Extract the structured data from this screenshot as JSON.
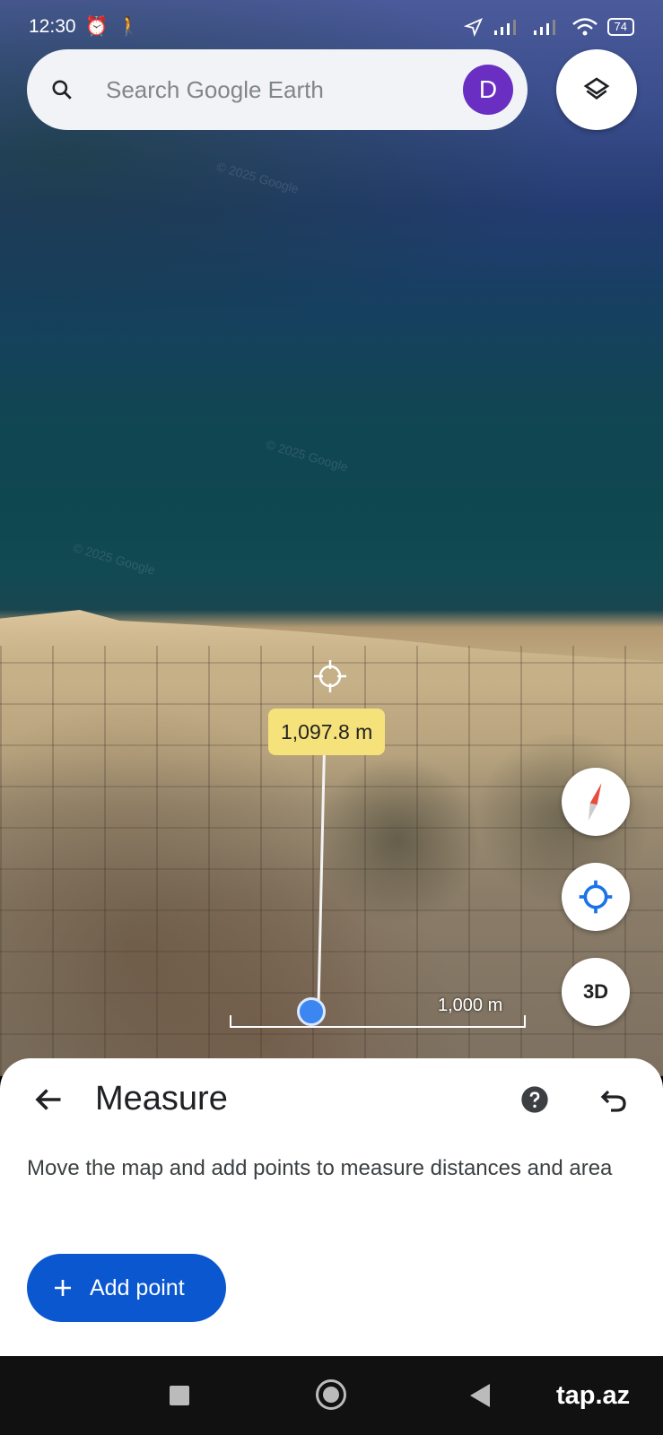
{
  "status_bar": {
    "time": "12:30",
    "battery": "74",
    "icons": [
      "alarm-icon",
      "walking-icon",
      "location-arrow-icon",
      "signal-icon",
      "signal-icon",
      "wifi-icon",
      "battery-icon"
    ]
  },
  "search": {
    "placeholder": "Search Google Earth",
    "avatar_initial": "D",
    "avatar_color": "#6a2ec2"
  },
  "map": {
    "watermark": "© 2025 Google",
    "distance_label": "1,097.8 m",
    "scale_label": "1,000 m"
  },
  "fabs": {
    "three_d_label": "3D"
  },
  "sheet": {
    "title": "Measure",
    "description": "Move the map and add points to measure distances and area",
    "add_point_label": "Add point"
  },
  "source_watermark": "tap.az",
  "colors": {
    "primary_button": "#0b57d0",
    "distance_label_bg": "#f6e27a",
    "point": "#3b86f0"
  }
}
